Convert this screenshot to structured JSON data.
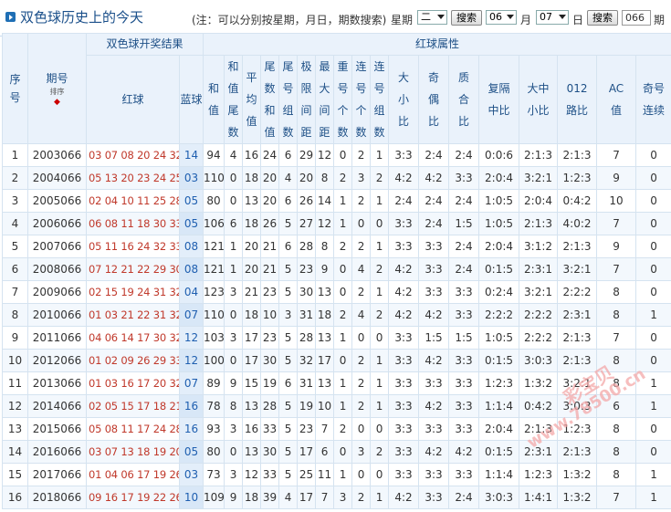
{
  "header": {
    "title": "双色球历史上的今天",
    "note": "(注：可以分别按星期，月日，期数搜索)",
    "week_label": "星期",
    "week_value": "二",
    "search_label": "搜索",
    "month_value": "06",
    "month_label": "月",
    "day_value": "07",
    "day_label": "日",
    "issue_value": "066",
    "issue_label": "期"
  },
  "columns": {
    "group_results": "双色球开奖结果",
    "group_attrs": "红球属性",
    "seq": "序号",
    "issue": "期号",
    "sort_label": "排序",
    "red": "红球",
    "blue": "蓝球",
    "attrs": [
      "和值",
      "和值尾数",
      "平均值",
      "尾数和值",
      "尾号组数",
      "极限间距",
      "最大间距",
      "重号个数",
      "连号个数",
      "连号组数",
      "大小比",
      "奇偶比",
      "质合比",
      "复隔中比",
      "大中小比",
      "012路比",
      "AC值",
      "奇号连续"
    ]
  },
  "rows": [
    {
      "seq": "1",
      "issue": "2003066",
      "red": "03 07 08 20 24 32",
      "blue": "14",
      "v": [
        "94",
        "4",
        "16",
        "24",
        "6",
        "29",
        "12",
        "0",
        "2",
        "1",
        "3:3",
        "2:4",
        "2:4",
        "0:0:6",
        "2:1:3",
        "2:1:3",
        "7",
        "0"
      ]
    },
    {
      "seq": "2",
      "issue": "2004066",
      "red": "05 13 20 23 24 25",
      "blue": "03",
      "v": [
        "110",
        "0",
        "18",
        "20",
        "4",
        "20",
        "8",
        "2",
        "3",
        "2",
        "4:2",
        "4:2",
        "3:3",
        "2:0:4",
        "3:2:1",
        "1:2:3",
        "9",
        "0"
      ]
    },
    {
      "seq": "3",
      "issue": "2005066",
      "red": "02 04 10 11 25 28",
      "blue": "05",
      "v": [
        "80",
        "0",
        "13",
        "20",
        "6",
        "26",
        "14",
        "1",
        "2",
        "1",
        "2:4",
        "2:4",
        "2:4",
        "1:0:5",
        "2:0:4",
        "0:4:2",
        "10",
        "0"
      ]
    },
    {
      "seq": "4",
      "issue": "2006066",
      "red": "06 08 11 18 30 33",
      "blue": "05",
      "v": [
        "106",
        "6",
        "18",
        "26",
        "5",
        "27",
        "12",
        "1",
        "0",
        "0",
        "3:3",
        "2:4",
        "1:5",
        "1:0:5",
        "2:1:3",
        "4:0:2",
        "7",
        "0"
      ]
    },
    {
      "seq": "5",
      "issue": "2007066",
      "red": "05 11 16 24 32 33",
      "blue": "08",
      "v": [
        "121",
        "1",
        "20",
        "21",
        "6",
        "28",
        "8",
        "2",
        "2",
        "1",
        "3:3",
        "3:3",
        "2:4",
        "2:0:4",
        "3:1:2",
        "2:1:3",
        "9",
        "0"
      ]
    },
    {
      "seq": "6",
      "issue": "2008066",
      "red": "07 12 21 22 29 30",
      "blue": "08",
      "v": [
        "121",
        "1",
        "20",
        "21",
        "5",
        "23",
        "9",
        "0",
        "4",
        "2",
        "4:2",
        "3:3",
        "2:4",
        "0:1:5",
        "2:3:1",
        "3:2:1",
        "7",
        "0"
      ]
    },
    {
      "seq": "7",
      "issue": "2009066",
      "red": "02 15 19 24 31 32",
      "blue": "04",
      "v": [
        "123",
        "3",
        "21",
        "23",
        "5",
        "30",
        "13",
        "0",
        "2",
        "1",
        "4:2",
        "3:3",
        "3:3",
        "0:2:4",
        "3:2:1",
        "2:2:2",
        "8",
        "0"
      ]
    },
    {
      "seq": "8",
      "issue": "2010066",
      "red": "01 03 21 22 31 32",
      "blue": "07",
      "v": [
        "110",
        "0",
        "18",
        "10",
        "3",
        "31",
        "18",
        "2",
        "4",
        "2",
        "4:2",
        "4:2",
        "3:3",
        "2:2:2",
        "2:2:2",
        "2:3:1",
        "8",
        "1"
      ]
    },
    {
      "seq": "9",
      "issue": "2011066",
      "red": "04 06 14 17 30 32",
      "blue": "12",
      "v": [
        "103",
        "3",
        "17",
        "23",
        "5",
        "28",
        "13",
        "1",
        "0",
        "0",
        "3:3",
        "1:5",
        "1:5",
        "1:0:5",
        "2:2:2",
        "2:1:3",
        "7",
        "0"
      ]
    },
    {
      "seq": "10",
      "issue": "2012066",
      "red": "01 02 09 26 29 33",
      "blue": "12",
      "v": [
        "100",
        "0",
        "17",
        "30",
        "5",
        "32",
        "17",
        "0",
        "2",
        "1",
        "3:3",
        "4:2",
        "3:3",
        "0:1:5",
        "3:0:3",
        "2:1:3",
        "8",
        "0"
      ]
    },
    {
      "seq": "11",
      "issue": "2013066",
      "red": "01 03 16 17 20 32",
      "blue": "07",
      "v": [
        "89",
        "9",
        "15",
        "19",
        "6",
        "31",
        "13",
        "1",
        "2",
        "1",
        "3:3",
        "3:3",
        "3:3",
        "1:2:3",
        "1:3:2",
        "3:2:1",
        "8",
        "1"
      ]
    },
    {
      "seq": "12",
      "issue": "2014066",
      "red": "02 05 15 17 18 21",
      "blue": "16",
      "v": [
        "78",
        "8",
        "13",
        "28",
        "5",
        "19",
        "10",
        "1",
        "2",
        "1",
        "3:3",
        "4:2",
        "3:3",
        "1:1:4",
        "0:4:2",
        "3:0:3",
        "6",
        "1"
      ]
    },
    {
      "seq": "13",
      "issue": "2015066",
      "red": "05 08 11 17 24 28",
      "blue": "16",
      "v": [
        "93",
        "3",
        "16",
        "33",
        "5",
        "23",
        "7",
        "2",
        "0",
        "0",
        "3:3",
        "3:3",
        "3:3",
        "2:0:4",
        "2:1:3",
        "1:2:3",
        "8",
        "0"
      ]
    },
    {
      "seq": "14",
      "issue": "2016066",
      "red": "03 07 13 18 19 20",
      "blue": "05",
      "v": [
        "80",
        "0",
        "13",
        "30",
        "5",
        "17",
        "6",
        "0",
        "3",
        "2",
        "3:3",
        "4:2",
        "4:2",
        "0:1:5",
        "2:3:1",
        "2:1:3",
        "8",
        "0"
      ]
    },
    {
      "seq": "15",
      "issue": "2017066",
      "red": "01 04 06 17 19 26",
      "blue": "03",
      "v": [
        "73",
        "3",
        "12",
        "33",
        "5",
        "25",
        "11",
        "1",
        "0",
        "0",
        "3:3",
        "3:3",
        "3:3",
        "1:1:4",
        "1:2:3",
        "1:3:2",
        "8",
        "1"
      ]
    },
    {
      "seq": "16",
      "issue": "2018066",
      "red": "09 16 17 19 22 26",
      "blue": "10",
      "v": [
        "109",
        "9",
        "18",
        "39",
        "4",
        "17",
        "7",
        "3",
        "2",
        "1",
        "4:2",
        "3:3",
        "2:4",
        "3:0:3",
        "1:4:1",
        "1:3:2",
        "7",
        "1"
      ]
    }
  ],
  "watermark": {
    "cn": "彩宝贝",
    "url": "www.78500.cn"
  }
}
